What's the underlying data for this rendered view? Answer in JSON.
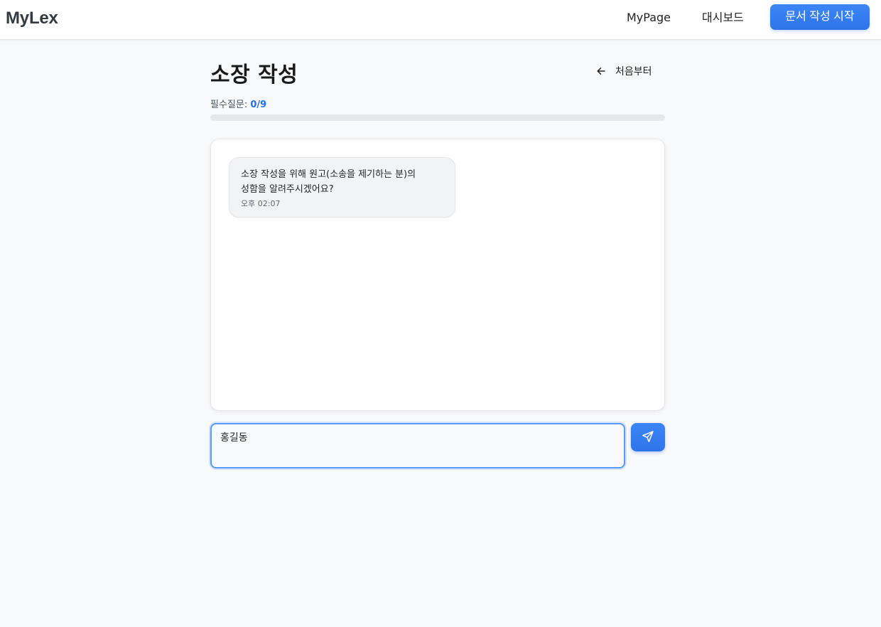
{
  "header": {
    "brand": "MyLex",
    "nav": {
      "mypage": "MyPage",
      "dashboard": "대시보드",
      "cta": "문서 작성 시작"
    }
  },
  "page": {
    "title": "소장 작성",
    "restart_label": "처음부터",
    "restart_icon": "arrow-left-icon"
  },
  "progress": {
    "label": "필수질문:",
    "value_text": "0/9",
    "answered": 0,
    "total": 9
  },
  "chat": {
    "messages": [
      {
        "sender": "assistant",
        "text": "소장 작성을 위해 원고(소송을 제기하는 분)의\n성함을 알려주시겠어요?",
        "time": "오후 02:07"
      }
    ]
  },
  "composer": {
    "value": "홍길동",
    "send_icon": "send-icon"
  },
  "colors": {
    "accent": "#2f74ea",
    "progress_value": "#1f6feb",
    "background": "#f8f9fb"
  }
}
